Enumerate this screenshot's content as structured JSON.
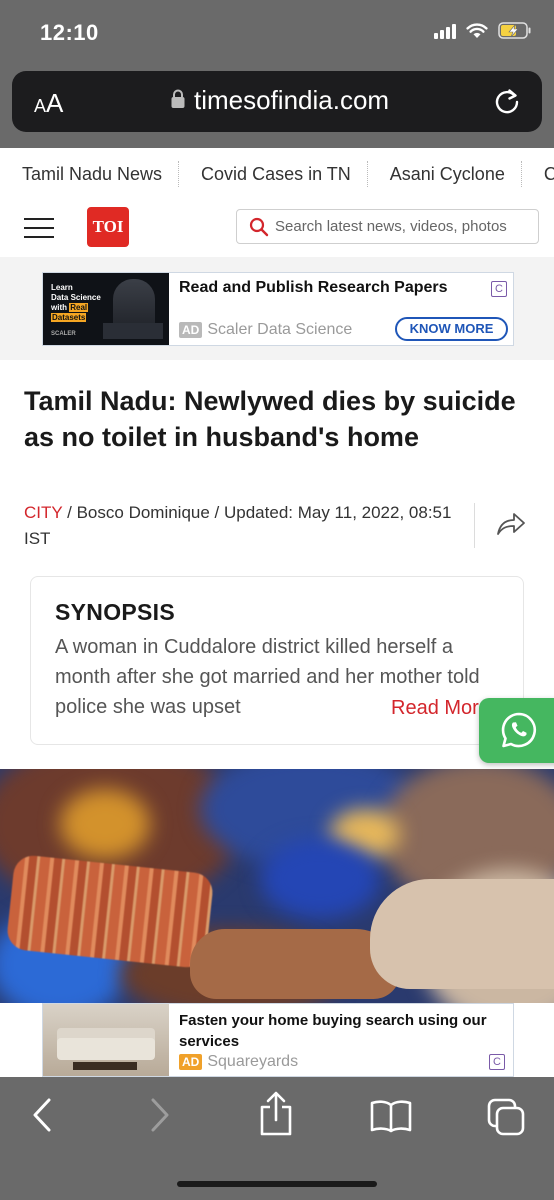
{
  "status_bar": {
    "time": "12:10"
  },
  "browser": {
    "aa_label_small": "A",
    "aa_label_large": "A",
    "url": "timesofindia.com"
  },
  "trending": [
    "Tamil Nadu News",
    "Covid Cases in TN",
    "Asani Cyclone",
    "C"
  ],
  "header": {
    "logo_text": "TOI",
    "search_placeholder": "Search latest news, videos, photos"
  },
  "ad_top": {
    "image_line1": "Learn",
    "image_line2": "Data Science",
    "image_line3": "with",
    "image_line3_hl": "Real",
    "image_line4": "Datasets",
    "image_brand": "SCALER",
    "title": "Read and Publish Research Papers",
    "badge": "AD",
    "source": "Scaler Data Science",
    "cta": "KNOW MORE",
    "adchoices": "C"
  },
  "article": {
    "headline": "Tamil Nadu: Newlywed dies by suicide as no toilet in husband's home",
    "category": "CITY",
    "byline_rest": " / Bosco Dominique / Updated: May 11, 2022, 08:51 IST",
    "synopsis_title": "SYNOPSIS",
    "synopsis_text": "A woman in Cuddalore district killed herself a month after she got married and her mother told police she was upset",
    "read_more": "Read More"
  },
  "ad_bottom": {
    "title": "Fasten your home buying search using our services",
    "badge": "AD",
    "source": "Squareyards",
    "adchoices": "C"
  },
  "icons": {
    "back": "chevron-left-icon",
    "forward": "chevron-right-icon",
    "share": "share-icon",
    "bookmarks": "book-icon",
    "tabs": "tabs-icon"
  }
}
